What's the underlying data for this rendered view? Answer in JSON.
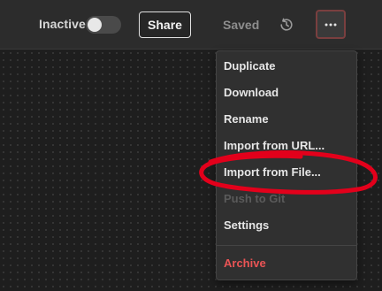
{
  "toolbar": {
    "status_label": "Inactive",
    "toggle_on": false,
    "share_label": "Share",
    "saved_label": "Saved",
    "history_icon": "history-icon",
    "more_icon": "ellipsis-icon"
  },
  "menu": {
    "items": [
      {
        "label": "Duplicate",
        "state": "enabled"
      },
      {
        "label": "Download",
        "state": "enabled"
      },
      {
        "label": "Rename",
        "state": "enabled"
      },
      {
        "label": "Import from URL...",
        "state": "enabled"
      },
      {
        "label": "Import from File...",
        "state": "highlighted"
      },
      {
        "label": "Push to Git",
        "state": "disabled"
      },
      {
        "label": "Settings",
        "state": "enabled"
      }
    ],
    "danger_item": {
      "label": "Archive"
    }
  },
  "colors": {
    "toolbar_bg": "#2c2c2c",
    "canvas_bg": "#1e1e1e",
    "menu_bg": "#303030",
    "danger": "#ea5455",
    "annotation": "#e3001b"
  }
}
